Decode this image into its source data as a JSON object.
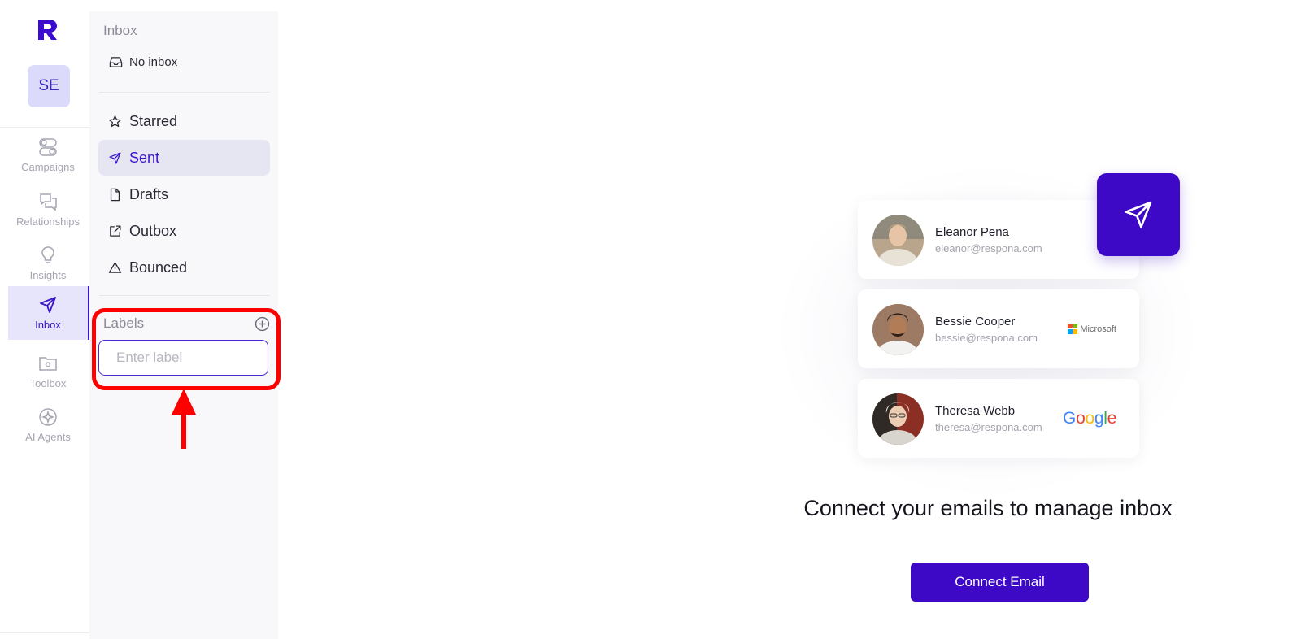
{
  "rail": {
    "workspace_initials": "SE",
    "items": [
      {
        "label": "Campaigns",
        "icon": "toggles-icon"
      },
      {
        "label": "Relationships",
        "icon": "chat-bubbles-icon"
      },
      {
        "label": "Insights",
        "icon": "lightbulb-icon"
      },
      {
        "label": "Inbox",
        "icon": "send-icon",
        "active": true
      },
      {
        "label": "Toolbox",
        "icon": "gear-folder-icon"
      },
      {
        "label": "AI Agents",
        "icon": "ai-star-icon"
      }
    ]
  },
  "sidebar": {
    "title": "Inbox",
    "no_inbox": "No inbox",
    "nav": [
      {
        "label": "Starred",
        "icon": "star-icon"
      },
      {
        "label": "Sent",
        "icon": "send-icon",
        "active": true
      },
      {
        "label": "Drafts",
        "icon": "file-icon"
      },
      {
        "label": "Outbox",
        "icon": "external-link-icon"
      },
      {
        "label": "Bounced",
        "icon": "warning-icon"
      }
    ],
    "labels_title": "Labels",
    "label_input_placeholder": "Enter label"
  },
  "main": {
    "contacts": [
      {
        "name": "Eleanor Pena",
        "email": "eleanor@respona.com",
        "brand": ""
      },
      {
        "name": "Bessie Cooper",
        "email": "bessie@respona.com",
        "brand": "Microsoft"
      },
      {
        "name": "Theresa Webb",
        "email": "theresa@respona.com",
        "brand": "Google"
      }
    ],
    "headline": "Connect your emails to manage inbox",
    "connect_button": "Connect Email"
  },
  "colors": {
    "accent": "#3d08c6",
    "active_bg": "#e7e5fc",
    "annotation": "#ff0000"
  }
}
